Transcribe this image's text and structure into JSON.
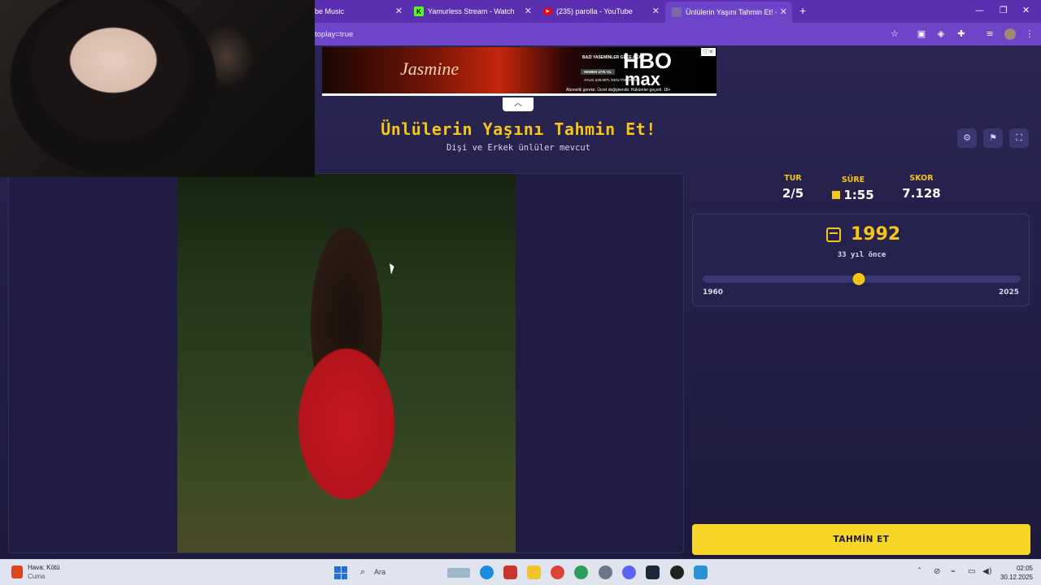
{
  "browser": {
    "tabs": [
      {
        "label": "be Music"
      },
      {
        "label": "Yamurless Stream - Watch Live"
      },
      {
        "label": "(235) parolla - YouTube"
      },
      {
        "label": "Ünlülerin Yaşını Tahmin Et! - Q..."
      }
    ],
    "url": "toplay=true"
  },
  "ad": {
    "title": "Jasmine",
    "tagline": "BAZI YASEMİNLER GECE AÇAR",
    "button": "HEMEN ÜYE OL",
    "price": "AYLIK 229,90TL'DEN İTİBAREN",
    "brand_top": "HBO",
    "brand_bottom": "max",
    "footer": "Abonelik gerekir. Ücret değişkendir. Hükümler geçerli. 18+"
  },
  "game": {
    "title": "Ünlülerin Yaşını Tahmin Et!",
    "subtitle": "Dişi ve Erkek ünlüler mevcut"
  },
  "stats": {
    "round_label": "TUR",
    "round_value": "2/5",
    "time_label": "SÜRE",
    "time_value": "1:55",
    "score_label": "SKOR",
    "score_value": "7.128"
  },
  "year_picker": {
    "year": "1992",
    "years_ago": "33 yıl önce",
    "min": "1960",
    "max": "2025",
    "value": 1992,
    "range": [
      1960,
      2025
    ]
  },
  "guess_button": "TAHMİN ET",
  "taskbar": {
    "weather_title": "Hava: Kötü",
    "weather_day": "Cuma",
    "search_placeholder": "Ara",
    "time": "02:05",
    "date": "30.12.2025"
  },
  "colors": {
    "accent": "#f5c518",
    "tabbar": "#5a2fb0",
    "page_bg": "#1e1b3c"
  }
}
